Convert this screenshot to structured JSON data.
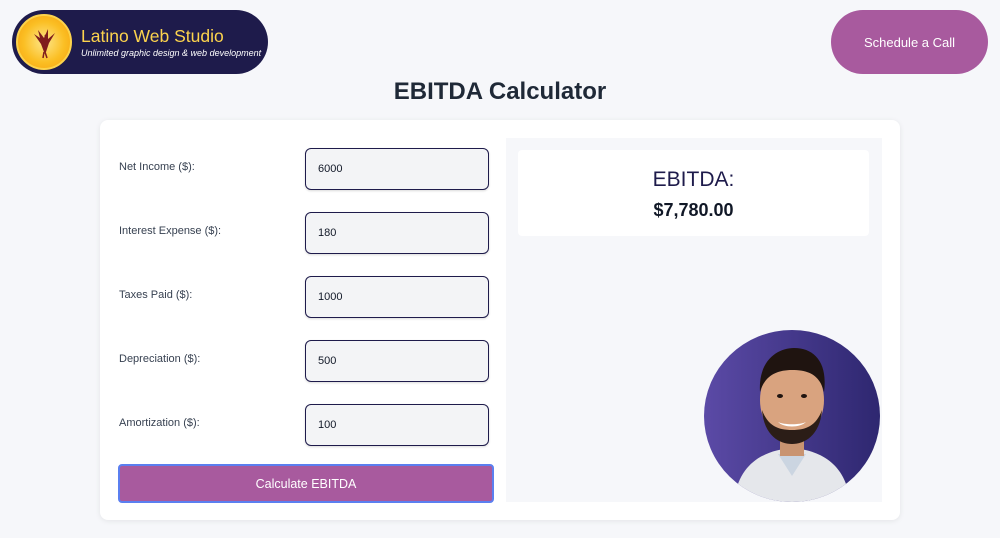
{
  "brand": {
    "name": "Latino Web Studio",
    "tagline": "Unlimited graphic design & web development"
  },
  "header": {
    "cta_label": "Schedule a Call"
  },
  "page": {
    "title": "EBITDA Calculator"
  },
  "form": {
    "fields": [
      {
        "label": "Net Income ($):",
        "value": "6000"
      },
      {
        "label": "Interest Expense ($):",
        "value": "180"
      },
      {
        "label": "Taxes Paid ($):",
        "value": "1000"
      },
      {
        "label": "Depreciation ($):",
        "value": "500"
      },
      {
        "label": "Amortization ($):",
        "value": "100"
      }
    ],
    "submit_label": "Calculate EBITDA"
  },
  "result": {
    "label": "EBITDA:",
    "value": "$7,780.00"
  },
  "colors": {
    "brand_navy": "#1e1b4b",
    "brand_gold": "#fcd34d",
    "accent_purple": "#a85a9e",
    "focus_blue": "#5b7ff0"
  },
  "icons": {
    "logo": "phoenix-bird-icon",
    "avatar": "person-portrait"
  }
}
